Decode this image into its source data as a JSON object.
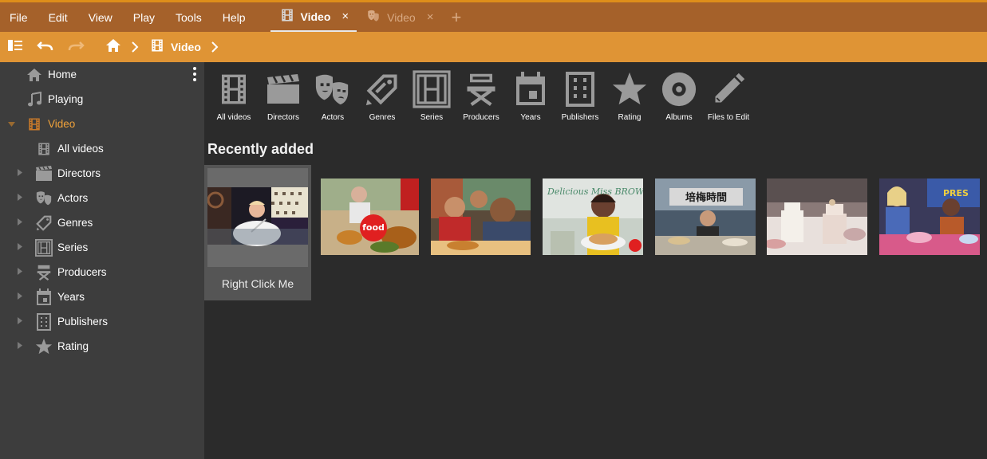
{
  "menu": [
    "File",
    "Edit",
    "View",
    "Play",
    "Tools",
    "Help"
  ],
  "tabs": [
    {
      "label": "Video",
      "close": "×",
      "active": true
    },
    {
      "label": "Video",
      "close": "×",
      "active": false
    }
  ],
  "tab_add": "+",
  "breadcrumb": {
    "current": "Video"
  },
  "sidebar": {
    "items": [
      {
        "label": "Home",
        "icon": "home-icon"
      },
      {
        "label": "Playing",
        "icon": "music-note-icon"
      },
      {
        "label": "Video",
        "icon": "film-strip-icon",
        "selected": true
      },
      {
        "label": "All videos",
        "icon": "film-strip-icon"
      },
      {
        "label": "Directors",
        "icon": "clapperboard-icon"
      },
      {
        "label": "Actors",
        "icon": "theater-masks-icon"
      },
      {
        "label": "Genres",
        "icon": "tag-pencil-icon"
      },
      {
        "label": "Series",
        "icon": "series-grid-icon"
      },
      {
        "label": "Producers",
        "icon": "director-chair-icon"
      },
      {
        "label": "Years",
        "icon": "calendar-icon"
      },
      {
        "label": "Publishers",
        "icon": "building-icon"
      },
      {
        "label": "Rating",
        "icon": "star-icon"
      }
    ]
  },
  "categories": [
    {
      "label": "All videos",
      "icon": "film-strip-icon"
    },
    {
      "label": "Directors",
      "icon": "clapperboard-icon"
    },
    {
      "label": "Actors",
      "icon": "theater-masks-icon"
    },
    {
      "label": "Genres",
      "icon": "tag-pencil-icon"
    },
    {
      "label": "Series",
      "icon": "series-grid-icon"
    },
    {
      "label": "Producers",
      "icon": "director-chair-icon"
    },
    {
      "label": "Years",
      "icon": "calendar-icon"
    },
    {
      "label": "Publishers",
      "icon": "building-icon"
    },
    {
      "label": "Rating",
      "icon": "star-icon"
    },
    {
      "label": "Albums",
      "icon": "disc-icon"
    },
    {
      "label": "Files to Edit",
      "icon": "pencil-icon"
    }
  ],
  "recent": {
    "title": "Recently added",
    "selected_caption": "Right Click Me",
    "thumbnails": [
      {
        "name": "chef-kitchen-thumbnail",
        "badge": ""
      },
      {
        "name": "food-network-turkey-thumbnail",
        "badge": "food"
      },
      {
        "name": "two-chefs-eating-thumbnail",
        "badge": ""
      },
      {
        "name": "delicious-miss-brown-thumbnail",
        "badge": "Delicious Miss BROWN"
      },
      {
        "name": "chinese-cooking-show-thumbnail",
        "badge": "培梅時間"
      },
      {
        "name": "wedding-cakes-thumbnail",
        "badge": ""
      },
      {
        "name": "baking-competition-thumbnail",
        "badge": "PRES"
      }
    ]
  },
  "colors": {
    "menubar": "#a5612a",
    "toolbar": "#df9435",
    "accent_selected": "#f0a23a",
    "sidebar_bg": "#3d3d3d",
    "main_bg": "#2b2b2b",
    "icon_gray": "#9a9a9a"
  }
}
